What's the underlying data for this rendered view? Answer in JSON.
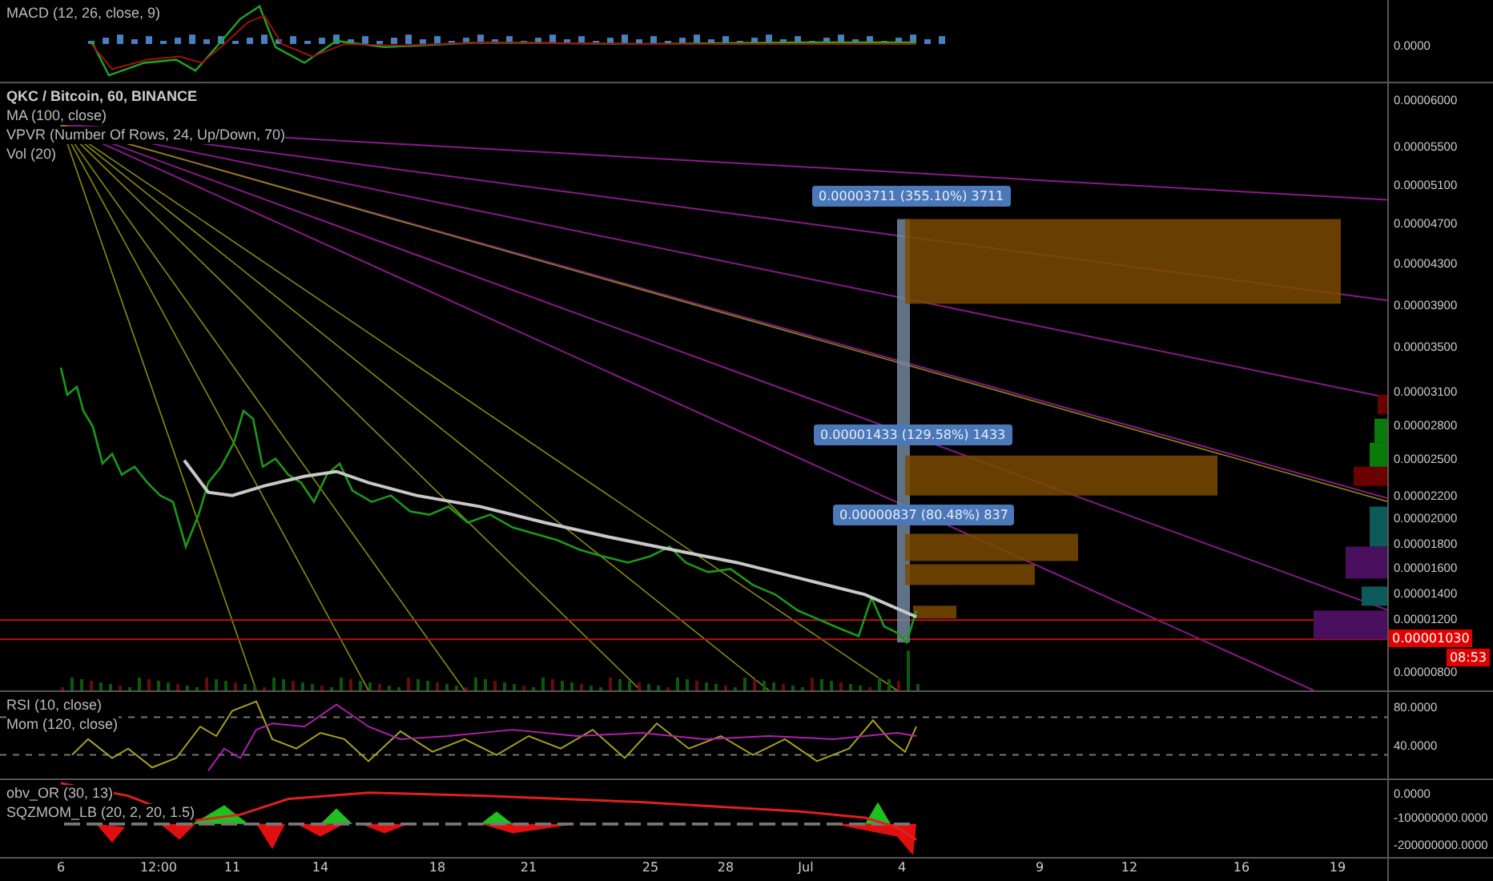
{
  "panes": [
    {
      "kind": "macd",
      "legend": [
        "MACD (12, 26, close, 9)"
      ],
      "axis_labels": [
        "0.0000"
      ]
    },
    {
      "kind": "price",
      "legend": [
        "QKC / Bitcoin, 60, BINANCE",
        "MA (100, close)",
        "VPVR (Number Of Rows, 24, Up/Down, 70)",
        "Vol (20)"
      ],
      "axis_labels": [
        "0.00006000",
        "0.00005500",
        "0.00005100",
        "0.00004700",
        "0.00004300",
        "0.00003900",
        "0.00003500",
        "0.00003100",
        "0.00002800",
        "0.00002500",
        "0.00002200",
        "0.00002000",
        "0.00001800",
        "0.00001600",
        "0.00001400",
        "0.00001200",
        "0.00000800"
      ],
      "last_price_tag": "0.00001030",
      "countdown_tag": "08:53",
      "measurements": [
        "0.00003711 (355.10%) 3711",
        "0.00001433 (129.58%) 1433",
        "0.00000837 (80.48%) 837"
      ]
    },
    {
      "kind": "rsi",
      "legend": [
        "RSI (10, close)",
        "Mom (120, close)"
      ],
      "axis_labels": [
        "80.0000",
        "40.0000"
      ]
    },
    {
      "kind": "obv",
      "legend": [
        "obv_OR (30, 13)",
        "SQZMOM_LB (20, 2, 20, 1.5)"
      ],
      "axis_labels": [
        "0.0000",
        "-100000000.0000",
        "-200000000.0000"
      ]
    }
  ],
  "time_axis": {
    "labels": [
      "6",
      "12:00",
      "11",
      "14",
      "18",
      "21",
      "25",
      "28",
      "Jul",
      "4",
      "9",
      "12",
      "16",
      "19"
    ]
  }
}
